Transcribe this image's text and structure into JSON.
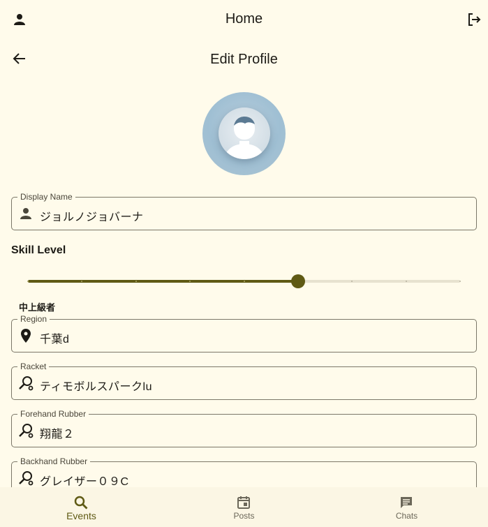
{
  "appbar": {
    "title": "Home"
  },
  "subbar": {
    "title": "Edit Profile"
  },
  "fields": {
    "display_name": {
      "label": "Display Name",
      "value": "ジョルノジョバーナ"
    },
    "region": {
      "label": "Region",
      "value": "千葉d"
    },
    "racket": {
      "label": "Racket",
      "value": "ティモボルスパークlu"
    },
    "forehand": {
      "label": "Forehand Rubber",
      "value": "翔龍２"
    },
    "backhand": {
      "label": "Backhand Rubber",
      "value": "グレイザー０９C"
    }
  },
  "skill": {
    "title": "Skill Level",
    "value_label": "中上級者",
    "level": 5,
    "max": 9
  },
  "nav": [
    {
      "label": "Events",
      "icon": "search-icon",
      "active": true
    },
    {
      "label": "Posts",
      "icon": "calendar-icon",
      "active": false
    },
    {
      "label": "Chats",
      "icon": "chat-icon",
      "active": false
    }
  ],
  "colors": {
    "background": "#fffbeb",
    "accent": "#5f5a14",
    "inactive_track": "#e7e2cf",
    "nav_inactive": "#6b6759"
  }
}
